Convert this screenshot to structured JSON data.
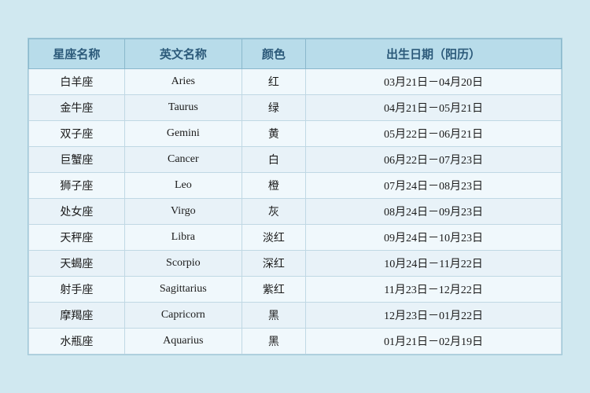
{
  "table": {
    "headers": {
      "chinese_name": "星座名称",
      "english_name": "英文名称",
      "color": "颜色",
      "birth_date": "出生日期（阳历）"
    },
    "rows": [
      {
        "chinese": "白羊座",
        "english": "Aries",
        "color": "红",
        "date": "03月21日－04月20日"
      },
      {
        "chinese": "金牛座",
        "english": "Taurus",
        "color": "绿",
        "date": "04月21日－05月21日"
      },
      {
        "chinese": "双子座",
        "english": "Gemini",
        "color": "黄",
        "date": "05月22日－06月21日"
      },
      {
        "chinese": "巨蟹座",
        "english": "Cancer",
        "color": "白",
        "date": "06月22日－07月23日"
      },
      {
        "chinese": "狮子座",
        "english": "Leo",
        "color": "橙",
        "date": "07月24日－08月23日"
      },
      {
        "chinese": "处女座",
        "english": "Virgo",
        "color": "灰",
        "date": "08月24日－09月23日"
      },
      {
        "chinese": "天秤座",
        "english": "Libra",
        "color": "淡红",
        "date": "09月24日－10月23日"
      },
      {
        "chinese": "天蝎座",
        "english": "Scorpio",
        "color": "深红",
        "date": "10月24日－11月22日"
      },
      {
        "chinese": "射手座",
        "english": "Sagittarius",
        "color": "紫红",
        "date": "11月23日－12月22日"
      },
      {
        "chinese": "摩羯座",
        "english": "Capricorn",
        "color": "黑",
        "date": "12月23日－01月22日"
      },
      {
        "chinese": "水瓶座",
        "english": "Aquarius",
        "color": "黑",
        "date": "01月21日－02月19日"
      }
    ]
  }
}
